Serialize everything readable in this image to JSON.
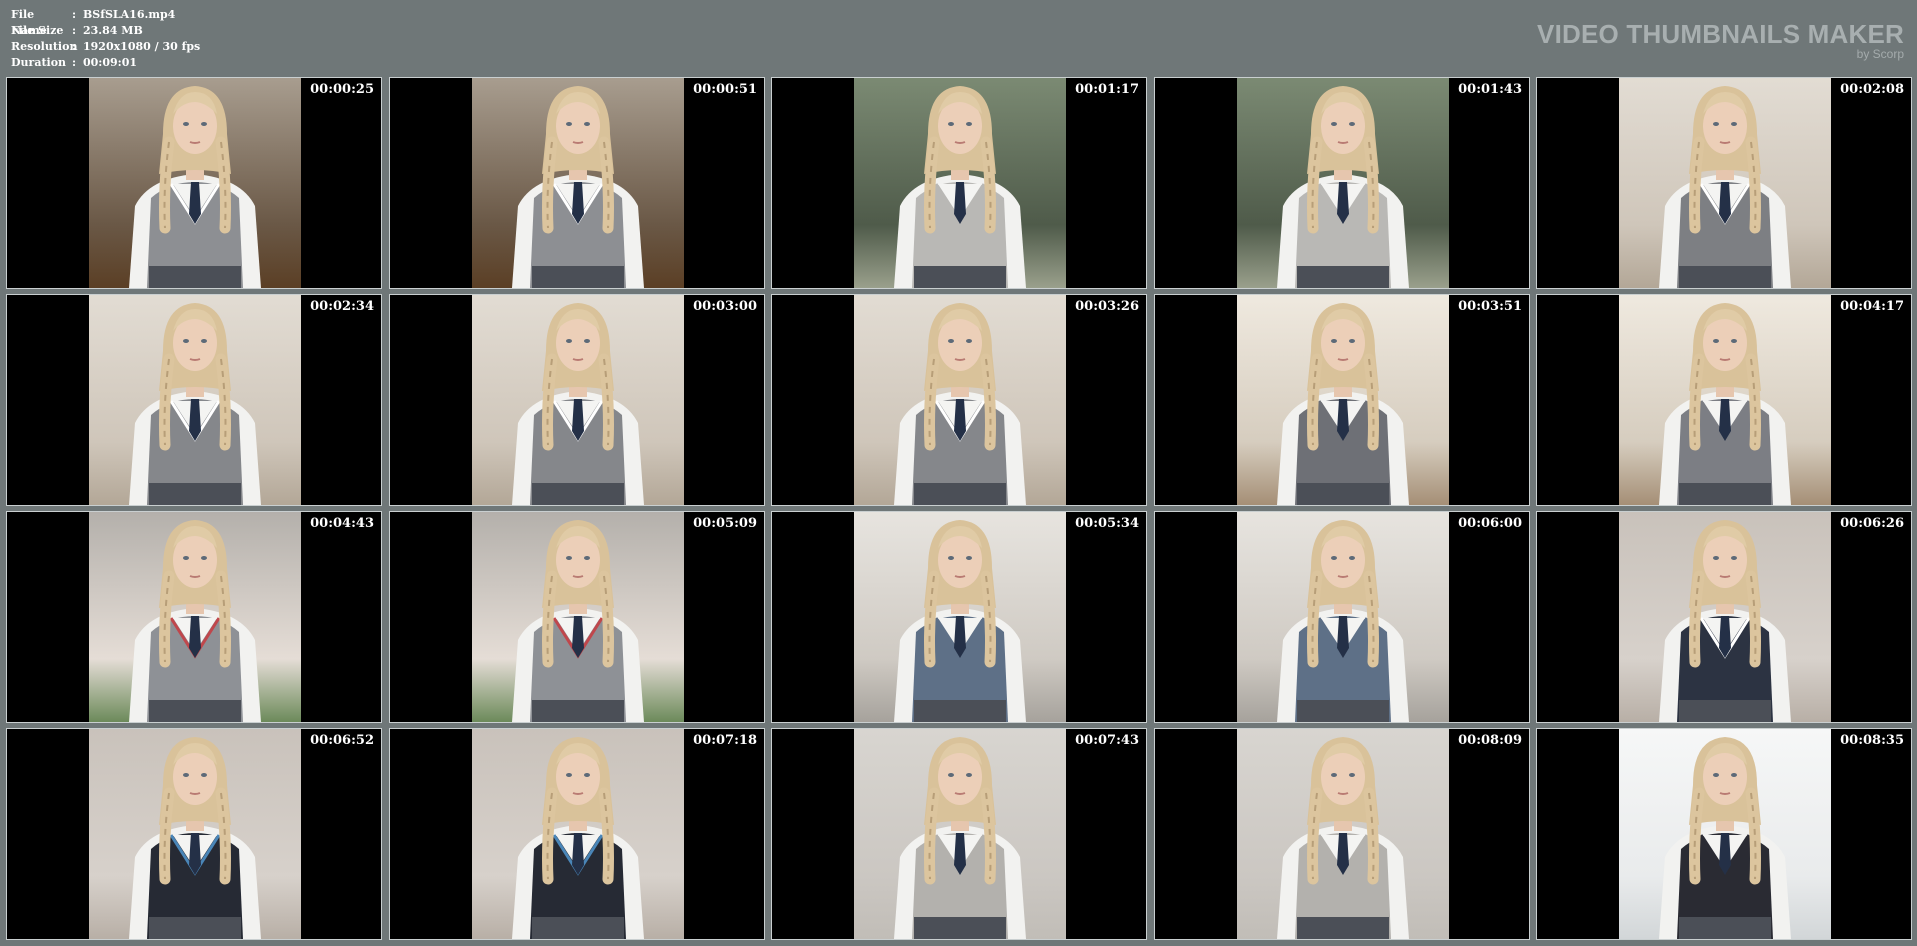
{
  "info": {
    "rows": [
      {
        "label": "File Name",
        "sep": ":",
        "value": "BSfSLA16.mp4"
      },
      {
        "label": "File Size",
        "sep": ":",
        "value": "23.84 MB"
      },
      {
        "label": "Resolution",
        "sep": ":",
        "value": "1920x1080 / 30 fps"
      },
      {
        "label": "Duration",
        "sep": ":",
        "value": "00:09:01"
      }
    ]
  },
  "brand": {
    "title": "VIDEO THUMBNAILS MAKER",
    "subtitle": "by Scorp"
  },
  "thumbnails": [
    {
      "timestamp": "00:00:25",
      "scene": "room",
      "vest": "#8d8f93",
      "trim": "#ffffff"
    },
    {
      "timestamp": "00:00:51",
      "scene": "room",
      "vest": "#8d8f93",
      "trim": "#ffffff"
    },
    {
      "timestamp": "00:01:17",
      "scene": "garden",
      "vest": "#b9b8b5",
      "trim": "#b9b8b5"
    },
    {
      "timestamp": "00:01:43",
      "scene": "garden",
      "vest": "#b9b8b5",
      "trim": "#b9b8b5"
    },
    {
      "timestamp": "00:02:08",
      "scene": "wall",
      "vest": "#7d7f83",
      "trim": "#ffffff"
    },
    {
      "timestamp": "00:02:34",
      "scene": "wall",
      "vest": "#85878b",
      "trim": "#ffffff"
    },
    {
      "timestamp": "00:03:00",
      "scene": "wall",
      "vest": "#85878b",
      "trim": "#ffffff"
    },
    {
      "timestamp": "00:03:26",
      "scene": "wall",
      "vest": "#85878b",
      "trim": "#ffffff"
    },
    {
      "timestamp": "00:03:51",
      "scene": "hall",
      "vest": "#6e7076",
      "trim": "#6e7076"
    },
    {
      "timestamp": "00:04:17",
      "scene": "hall",
      "vest": "#7c7e84",
      "trim": "#7c7e84"
    },
    {
      "timestamp": "00:04:43",
      "scene": "outdoor",
      "vest": "#8e9196",
      "trim": "#c0474c"
    },
    {
      "timestamp": "00:05:09",
      "scene": "outdoor",
      "vest": "#8e9196",
      "trim": "#c0474c"
    },
    {
      "timestamp": "00:05:34",
      "scene": "steps",
      "vest": "#5e7087",
      "trim": "#5e7087"
    },
    {
      "timestamp": "00:06:00",
      "scene": "steps",
      "vest": "#5e7087",
      "trim": "#5e7087"
    },
    {
      "timestamp": "00:06:26",
      "scene": "plain",
      "vest": "#2c3342",
      "trim": "#ffffff"
    },
    {
      "timestamp": "00:06:52",
      "scene": "plain",
      "vest": "#262a34",
      "trim": "#4a86b8"
    },
    {
      "timestamp": "00:07:18",
      "scene": "plain",
      "vest": "#262a34",
      "trim": "#4a86b8"
    },
    {
      "timestamp": "00:07:43",
      "scene": "studio",
      "vest": "#b3b1ad",
      "trim": "#b3b1ad"
    },
    {
      "timestamp": "00:08:09",
      "scene": "studio",
      "vest": "#b3b1ad",
      "trim": "#b3b1ad"
    },
    {
      "timestamp": "00:08:35",
      "scene": "whitewall",
      "vest": "#2a2b33",
      "trim": "#2a2b33"
    }
  ]
}
